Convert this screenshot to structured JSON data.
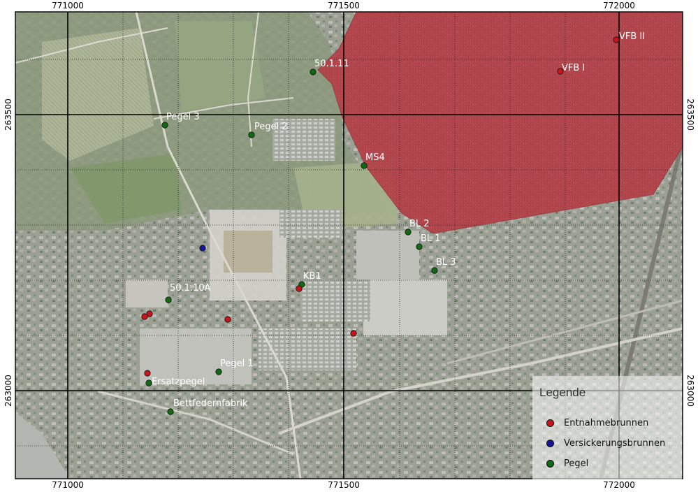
{
  "coordinates": {
    "x_top": [
      "771000",
      "771500",
      "772000"
    ],
    "x_bottom": [
      "771000",
      "771500",
      "772000"
    ],
    "y_left": [
      "263500",
      "263000"
    ],
    "y_right": [
      "263500",
      "263000"
    ]
  },
  "colors": {
    "entnahme": "#c8141b",
    "versickerung": "#15149a",
    "pegel": "#0f6a12",
    "zone": "#a8232c"
  },
  "wells": [
    {
      "label": "VFB II",
      "type": "entnahme"
    },
    {
      "label": "VFB I",
      "type": "entnahme"
    },
    {
      "label": "50.1.11",
      "type": "pegel"
    },
    {
      "label": "Pegel 3",
      "type": "pegel"
    },
    {
      "label": "Pegel 2",
      "type": "pegel"
    },
    {
      "label": "MS4",
      "type": "pegel"
    },
    {
      "label": "BL 2",
      "type": "pegel"
    },
    {
      "label": "BL 1",
      "type": "pegel"
    },
    {
      "label": "BL 3",
      "type": "pegel"
    },
    {
      "label": "KB1",
      "type": "pegel"
    },
    {
      "label": "50.1.10A",
      "type": "pegel"
    },
    {
      "label": "Pegel 1",
      "type": "pegel"
    },
    {
      "label": "Ersatzpegel",
      "type": "pegel"
    },
    {
      "label": "Bettfedernfabrik",
      "type": "pegel"
    },
    {
      "label": "",
      "type": "versickerung"
    },
    {
      "label": "",
      "type": "entnahme"
    },
    {
      "label": "",
      "type": "entnahme"
    },
    {
      "label": "",
      "type": "entnahme"
    },
    {
      "label": "",
      "type": "entnahme"
    },
    {
      "label": "",
      "type": "entnahme"
    },
    {
      "label": "",
      "type": "entnahme"
    }
  ],
  "legend": {
    "title": "Legende",
    "items": [
      {
        "label": "Entnahmebrunnen",
        "type": "entnahme"
      },
      {
        "label": "Versickerungsbrunnen",
        "type": "versickerung"
      },
      {
        "label": "Pegel",
        "type": "pegel"
      }
    ]
  }
}
